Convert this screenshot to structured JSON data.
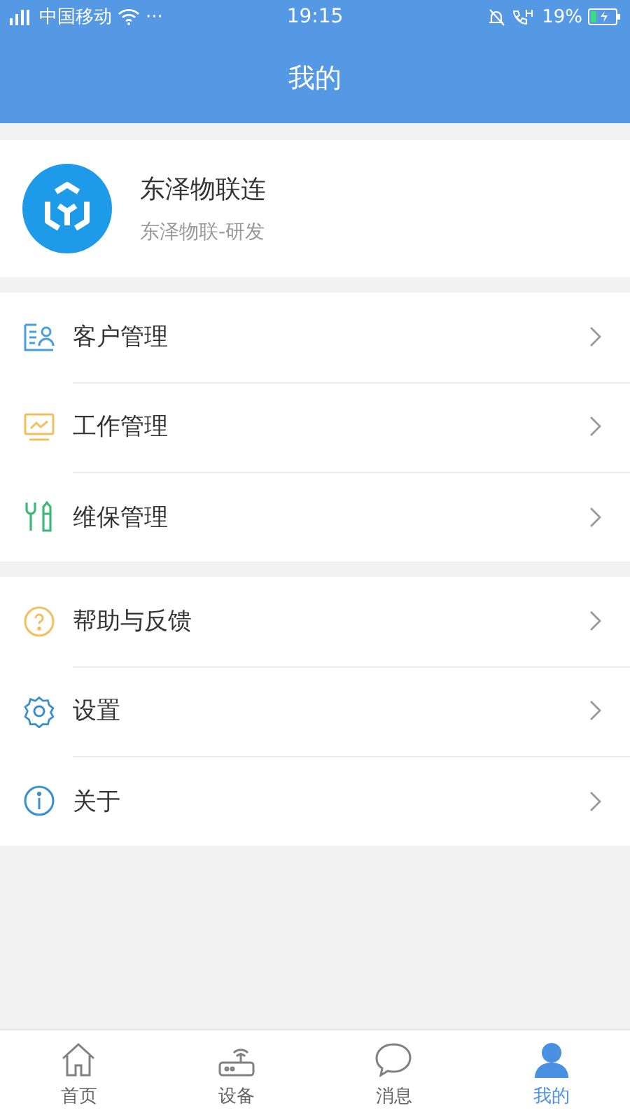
{
  "status_bar": {
    "carrier": "中国移动",
    "more": "···",
    "time": "19:15",
    "battery": "19%"
  },
  "header": {
    "title": "我的"
  },
  "profile": {
    "name": "东泽物联连",
    "subtitle": "东泽物联-研发"
  },
  "menu_groups": [
    [
      {
        "kind": "customers",
        "label": "客户管理"
      },
      {
        "kind": "work",
        "label": "工作管理"
      },
      {
        "kind": "maintenance",
        "label": "维保管理"
      }
    ],
    [
      {
        "kind": "help",
        "label": "帮助与反馈"
      },
      {
        "kind": "settings",
        "label": "设置"
      },
      {
        "kind": "about",
        "label": "关于"
      }
    ]
  ],
  "tab_bar": [
    {
      "kind": "home",
      "label": "首页",
      "selected": false
    },
    {
      "kind": "device",
      "label": "设备",
      "selected": false
    },
    {
      "kind": "message",
      "label": "消息",
      "selected": false
    },
    {
      "kind": "me",
      "label": "我的",
      "selected": true
    }
  ]
}
